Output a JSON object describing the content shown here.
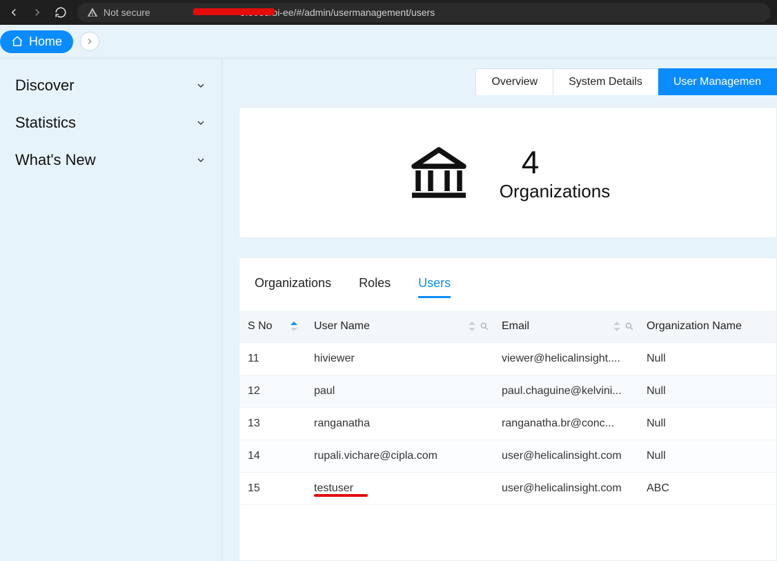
{
  "browser": {
    "not_secure_label": "Not secure",
    "url_suffix": "5:8085/bi-ee/#/admin/usermanagement/users"
  },
  "crumb": {
    "home_label": "Home"
  },
  "sidebar": {
    "items": [
      {
        "label": "Discover"
      },
      {
        "label": "Statistics"
      },
      {
        "label": "What's New"
      }
    ]
  },
  "top_tabs": {
    "overview": "Overview",
    "system_details": "System Details",
    "user_management": "User Managemen"
  },
  "org_card": {
    "count": "4",
    "label": "Organizations"
  },
  "sub_tabs": {
    "organizations": "Organizations",
    "roles": "Roles",
    "users": "Users"
  },
  "table": {
    "headers": {
      "sno": "S No",
      "user_name": "User Name",
      "email": "Email",
      "org_name": "Organization Name"
    },
    "rows": [
      {
        "sno": "11",
        "user_name": "hiviewer",
        "email": "viewer@helicalinsight....",
        "org": "Null"
      },
      {
        "sno": "12",
        "user_name": "paul",
        "email": "paul.chaguine@kelvini...",
        "org": "Null"
      },
      {
        "sno": "13",
        "user_name": "ranganatha",
        "email": "ranganatha.br@conc...",
        "org": "Null"
      },
      {
        "sno": "14",
        "user_name": "rupali.vichare@cipla.com",
        "email": "user@helicalinsight.com",
        "org": "Null"
      },
      {
        "sno": "15",
        "user_name": "testuser",
        "email": "user@helicalinsight.com",
        "org": "ABC"
      }
    ]
  }
}
